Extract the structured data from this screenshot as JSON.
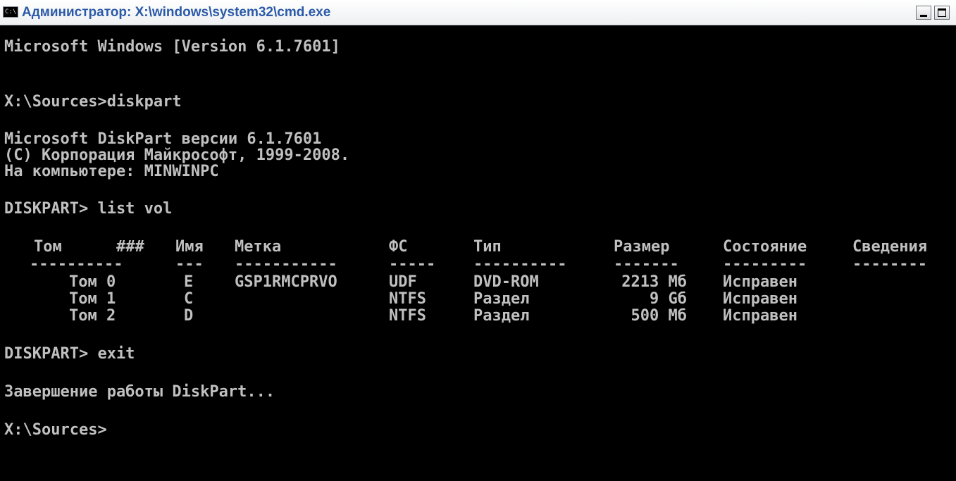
{
  "window": {
    "title": "Администратор: X:\\windows\\system32\\cmd.exe",
    "icon_text": "C:\\"
  },
  "console": {
    "version_line": "Microsoft Windows [Version 6.1.7601]",
    "prompt1": "X:\\Sources>diskpart",
    "dp_version": "Microsoft DiskPart версии 6.1.7601",
    "copyright": "(C) Корпорация Майкрософт, 1999-2008.",
    "computer": "На компьютере: MINWINPC",
    "prompt2": "DISKPART> list vol",
    "table": {
      "headers": [
        "Том",
        "###",
        "Имя",
        "Метка",
        "ФС",
        "Тип",
        "Размер",
        "Состояние",
        "Сведения"
      ],
      "separators": [
        "----------",
        "---",
        "-----------",
        "-----",
        "----------",
        "-------",
        "---------",
        "--------"
      ],
      "rows": [
        [
          "Том 0",
          "E",
          "GSP1RMCPRVO",
          "UDF",
          "DVD-ROM",
          "2213 Мб",
          "Исправен",
          ""
        ],
        [
          "Том 1",
          "C",
          "",
          "NTFS",
          "Раздел",
          "9 Gб",
          "Исправен",
          ""
        ],
        [
          "Том 2",
          "D",
          "",
          "NTFS",
          "Раздел",
          "500 Мб",
          "Исправен",
          ""
        ]
      ]
    },
    "prompt3": "DISKPART> exit",
    "exit_msg": "Завершение работы DiskPart...",
    "prompt4": "X:\\Sources>"
  }
}
